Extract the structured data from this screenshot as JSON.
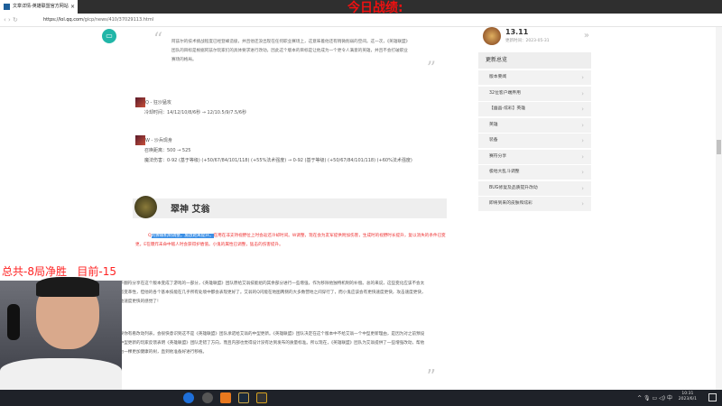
{
  "browser": {
    "tab_title": "文章详情-英雄联盟官方网站",
    "url_host": "https://lol.qq.com",
    "url_path": "/gicp/news/410/37029113.html",
    "close": "×",
    "nav": "‹ › ↻"
  },
  "overlay": {
    "top": "今日战绩:",
    "score": "总共-8局净胜   目前-15"
  },
  "article": {
    "quote1": "阿兹尔的技术挑战程度已经登峰造极，并且他还没出现在任何职业赛场上，这意味着他还有稍微削弱的空间。这一次，《英雄联盟》团队的目标是根据阿兹尔玩家们的具体要求进行改动，因此这个版本的目标是让他成为一个更令人满意的英雄，并且不会打破职业赛场的格局。",
    "quote_open": "“",
    "quote_close": "”",
    "skill_q": {
      "name": "Q - 狂沙猛攻",
      "line1": "冷却时间：14/12/10/8/6秒 → 12/10.5/9/7.5/6秒"
    },
    "skill_w": {
      "name": "W - 沙兵现身",
      "line1": "召唤距离：500 → 525",
      "line2": "魔法伤害：0-92 (基于等级) (+50/67/84/101/118) (+55%法术强度) → 0-92 (基于等级) (+50/67/84/101/118) (+60%法术强度)"
    },
    "champion": "翠神 艾翁",
    "red_prefix": "Q",
    "red_selected": "的獠眼机制调整，施放距离提升。",
    "red_rest": "在用在非支持视野位上时会返还冷却时间。W调整，现在会为友军提供附加伤害，生成时的视野时长提升，复以消失的条件已变更。E在爆炸未命中敌人时会获得护盾值。小鬼的属性已调整，猛击的伤害提升。",
    "para1": "由于翻符分享在这个版本变成了游戏的一部分，《英雄联盟》团队原给艾翁技能组的其余部分进行一些增强，作为移除他独特机制的补偿。总的来说，这些变化应该不会太具有变革性，但他的各个基本技能在几乎所有处境中都会表现更好了。艾翁的Q闪能在地图两侧的大多数营地之间穿行了，而小鬼应该会有更快速度更快，攻击速度更快，移动速度更快的感觉了!",
    "para2": "如果你有看改动列表，会很快意识到这不是《英雄联盟》团队承诺给艾翁的中型更新。《英雄联盟》团队决定在这个版本中不给艾翁一个中型更新理由，是因为对之前预设的中型更新的玩家反馈表明《英雄联盟》团队走错了方向，而且内部也觉得设计没有达到发布的质量标准。所以现在，《英雄联盟》团队为艾翁提供了一些增强改动，帮他成为一棵更加健康的树，直到他准备好进行移植。"
  },
  "sidebar": {
    "version": "13.11",
    "date": "更新时间：2023-05-31",
    "more": "»",
    "header": "更新总览",
    "items": [
      "版本要闻",
      "32位客户端弃用",
      "【幽晶-炫彩】英雄",
      "英雄",
      "装备",
      "赛符分享",
      "极地大乱斗调整",
      "BUG修复及品质提升改动",
      "即将到来的皮肤和炫彩"
    ],
    "chev": "›"
  },
  "taskbar": {
    "time": "10:31",
    "date": "2023/6/1",
    "tray": "^ 🎙 ▭ ◁) 中"
  }
}
